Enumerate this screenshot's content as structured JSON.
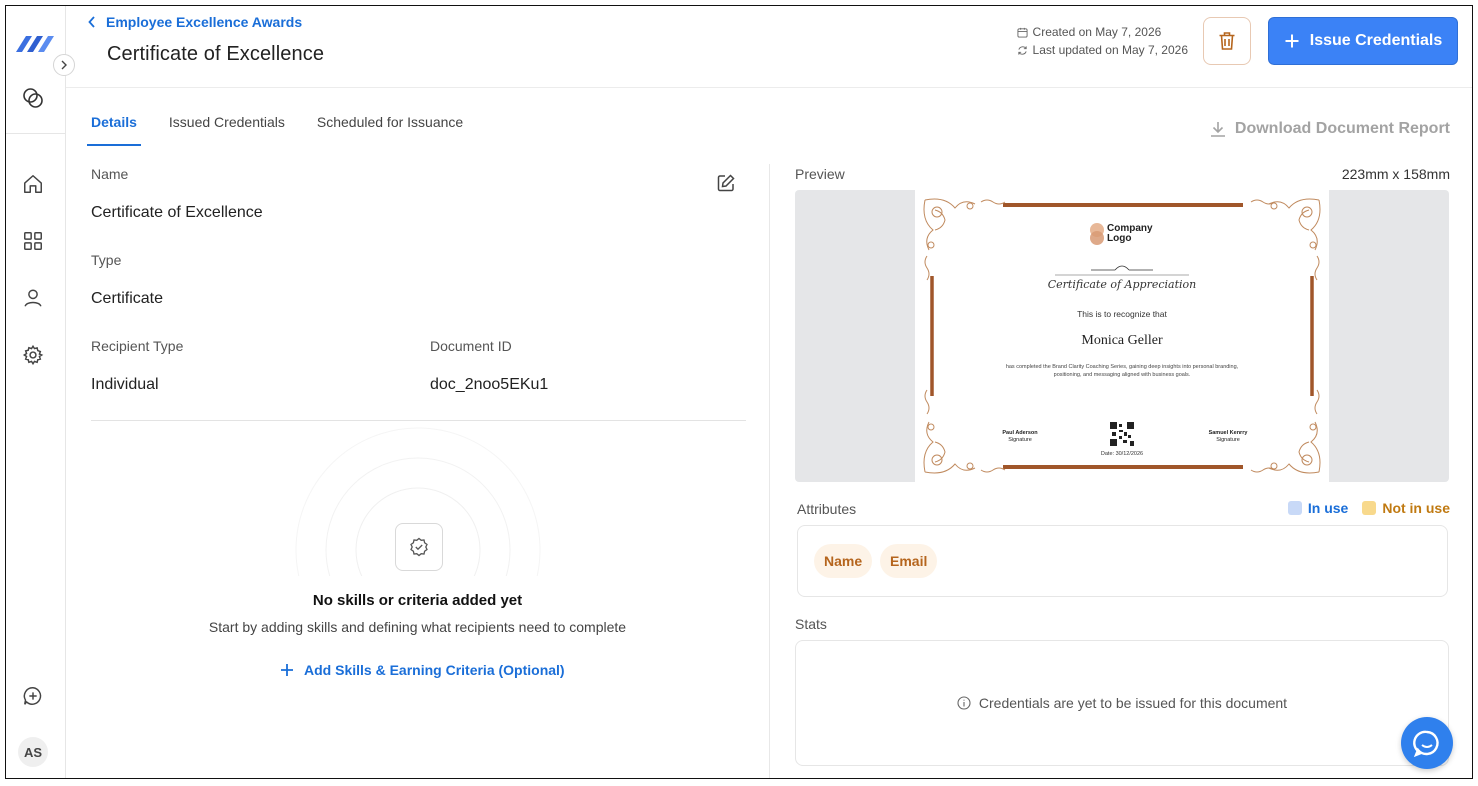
{
  "header": {
    "breadcrumb": "Employee Excellence Awards",
    "title": "Certificate of Excellence",
    "created": "Created on May 7, 2026",
    "updated": "Last updated on May 7, 2026",
    "issue_label": "Issue Credentials"
  },
  "sidebar": {
    "avatar_initials": "AS",
    "items": [
      "home-icon",
      "apps-grid-icon",
      "user-icon",
      "settings-icon"
    ]
  },
  "tabs": [
    {
      "label": "Details",
      "active": true
    },
    {
      "label": "Issued Credentials",
      "active": false
    },
    {
      "label": "Scheduled for Issuance",
      "active": false
    }
  ],
  "download_label": "Download Document Report",
  "details": {
    "name_label": "Name",
    "name_value": "Certificate of Excellence",
    "type_label": "Type",
    "type_value": "Certificate",
    "recipient_type_label": "Recipient Type",
    "recipient_type_value": "Individual",
    "document_id_label": "Document ID",
    "document_id_value": "doc_2noo5EKu1"
  },
  "empty_state": {
    "title": "No skills or criteria added yet",
    "subtitle": "Start by adding skills and defining what recipients need to complete",
    "action": "Add Skills & Earning Criteria (Optional)"
  },
  "preview": {
    "label": "Preview",
    "size": "223mm x 158mm",
    "certificate": {
      "logo_line1": "Company",
      "logo_line2": "Logo",
      "heading": "Certificate of Appreciation",
      "intro": "This is to recognize that",
      "recipient": "Monica Geller",
      "body_line1": "has completed the Brand Clarity Coaching Series, gaining deep insights into personal branding,",
      "body_line2": "positioning, and messaging aligned with business goals.",
      "signer1_name": "Paul Aderson",
      "signer1_role": "Signature",
      "signer2_name": "Samuel Kenrry",
      "signer2_role": "Signature",
      "date": "Date: 30/12/2026",
      "border_color": "#a0562a"
    }
  },
  "attributes": {
    "label": "Attributes",
    "legend_in_use": "In use",
    "legend_not_in_use": "Not in use",
    "in_use_color": "#c8d9f7",
    "not_in_use_color": "#f8d98c",
    "chips": [
      "Name",
      "Email"
    ]
  },
  "stats": {
    "label": "Stats",
    "message": "Credentials are yet to be issued for this document"
  }
}
